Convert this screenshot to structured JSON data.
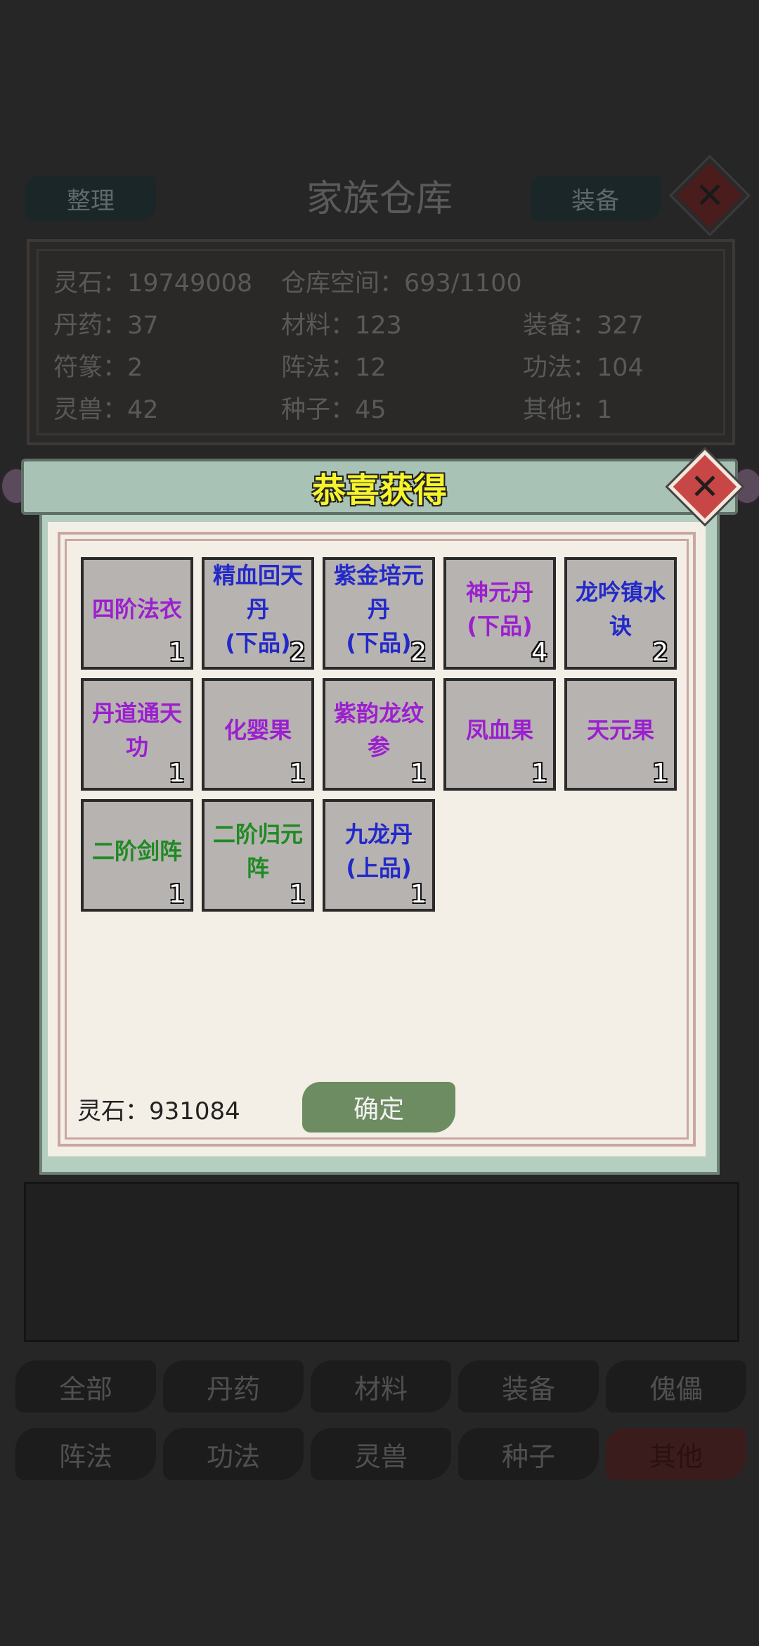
{
  "header": {
    "sort_label": "整理",
    "title": "家族仓库",
    "equip_label": "装备",
    "close_glyph": "✕"
  },
  "stats": {
    "spirit_stones": "灵石：19749008",
    "capacity": "仓库空间：693/1100",
    "pills": "丹药：37",
    "materials": "材料：123",
    "equipment": "装备：327",
    "talismans": "符篆：2",
    "formations": "阵法：12",
    "techniques": "功法：104",
    "beasts": "灵兽：42",
    "seeds": "种子：45",
    "others": "其他：1"
  },
  "tabs": [
    {
      "label": "全部"
    },
    {
      "label": "丹药"
    },
    {
      "label": "材料"
    },
    {
      "label": "装备"
    },
    {
      "label": "傀儡"
    },
    {
      "label": "阵法"
    },
    {
      "label": "功法"
    },
    {
      "label": "灵兽"
    },
    {
      "label": "种子"
    },
    {
      "label": "其他"
    }
  ],
  "active_tab": "其他",
  "popup": {
    "title": "恭喜获得",
    "close_glyph": "✕",
    "items": [
      {
        "name": "四阶法衣",
        "count": "1",
        "color": "#9b1fcf"
      },
      {
        "name": "精血回天丹(下品)",
        "count": "2",
        "color": "#2329c9"
      },
      {
        "name": "紫金培元丹(下品)",
        "count": "2",
        "color": "#2329c9"
      },
      {
        "name": "神元丹(下品)",
        "count": "4",
        "color": "#9b1fcf"
      },
      {
        "name": "龙吟镇水诀",
        "count": "2",
        "color": "#2329c9"
      },
      {
        "name": "丹道通天功",
        "count": "1",
        "color": "#9b1fcf"
      },
      {
        "name": "化婴果",
        "count": "1",
        "color": "#9b1fcf"
      },
      {
        "name": "紫韵龙纹参",
        "count": "1",
        "color": "#9b1fcf"
      },
      {
        "name": "凤血果",
        "count": "1",
        "color": "#9b1fcf"
      },
      {
        "name": "天元果",
        "count": "1",
        "color": "#9b1fcf"
      },
      {
        "name": "二阶剑阵",
        "count": "1",
        "color": "#1f8a24"
      },
      {
        "name": "二阶归元阵",
        "count": "1",
        "color": "#1f8a24"
      },
      {
        "name": "九龙丹(上品)",
        "count": "1",
        "color": "#2329c9"
      }
    ],
    "reward_stones": "灵石：931084",
    "confirm_label": "确定"
  }
}
